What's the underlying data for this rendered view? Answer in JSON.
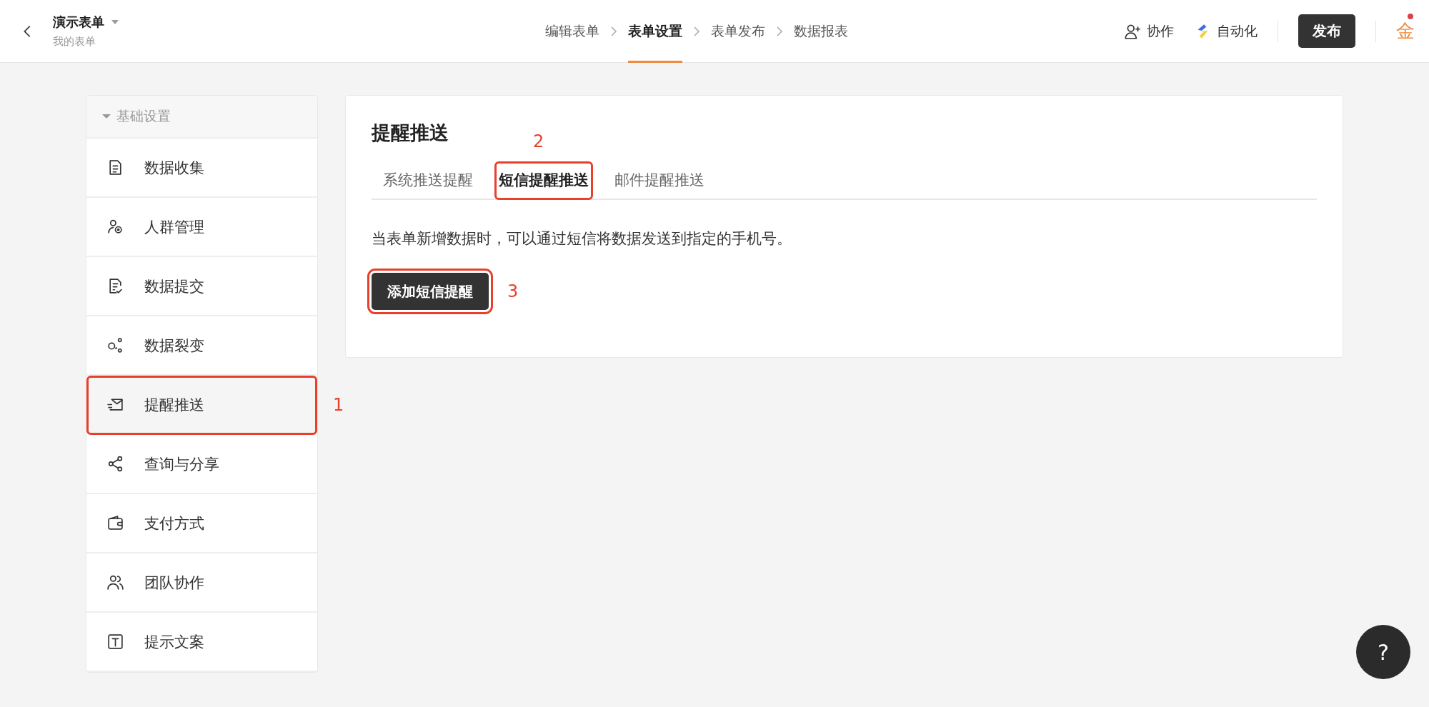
{
  "header": {
    "form_title": "演示表单",
    "form_subtitle": "我的表单",
    "steps": [
      {
        "label": "编辑表单",
        "selected": false
      },
      {
        "label": "表单设置",
        "selected": true
      },
      {
        "label": "表单发布",
        "selected": false
      },
      {
        "label": "数据报表",
        "selected": false
      }
    ],
    "collaborate": "协作",
    "automation": "自动化",
    "publish": "发布",
    "logo": "金"
  },
  "sidebar": {
    "group": "基础设置",
    "expanded": true,
    "items": [
      {
        "label": "数据收集",
        "selected": false
      },
      {
        "label": "人群管理",
        "selected": false
      },
      {
        "label": "数据提交",
        "selected": false
      },
      {
        "label": "数据裂变",
        "selected": false
      },
      {
        "label": "提醒推送",
        "selected": true,
        "annotation": "1"
      },
      {
        "label": "查询与分享",
        "selected": false
      },
      {
        "label": "支付方式",
        "selected": false
      },
      {
        "label": "团队协作",
        "selected": false
      },
      {
        "label": "提示文案",
        "selected": false
      }
    ]
  },
  "panel": {
    "title": "提醒推送",
    "tabs": [
      {
        "label": "系统推送提醒",
        "selected": false
      },
      {
        "label": "短信提醒推送",
        "selected": true,
        "annotation": "2"
      },
      {
        "label": "邮件提醒推送",
        "selected": false
      }
    ],
    "description": "当表单新增数据时，可以通过短信将数据发送到指定的手机号。",
    "button": {
      "label": "添加短信提醒",
      "annotation": "3"
    }
  },
  "help": "?"
}
